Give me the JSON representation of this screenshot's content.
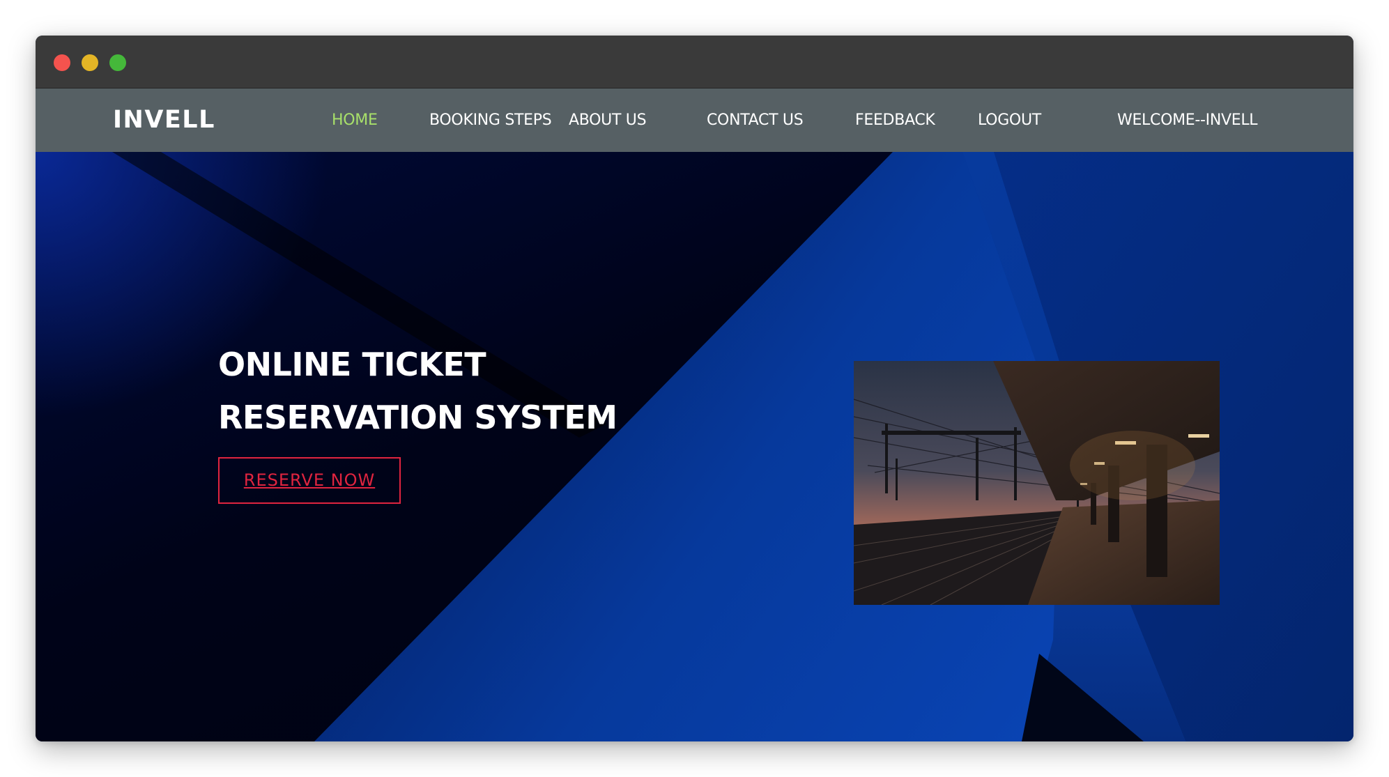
{
  "window": {
    "controls": [
      "close",
      "minimize",
      "maximize"
    ]
  },
  "nav": {
    "logo": "INVELL",
    "items": [
      {
        "label": "HOME",
        "active": true
      },
      {
        "label": "BOOKING STEPS",
        "active": false
      },
      {
        "label": "ABOUT US",
        "active": false
      },
      {
        "label": "CONTACT US",
        "active": false
      },
      {
        "label": "FEEDBACK",
        "active": false
      },
      {
        "label": "LOGOUT",
        "active": false
      },
      {
        "label": "WELCOME--INVELL",
        "active": false
      }
    ]
  },
  "hero": {
    "title_line1": "ONLINE TICKET",
    "title_line2": "RESERVATION SYSTEM",
    "cta_label": "RESERVE NOW",
    "image_alt": "train-station-platform-at-dusk"
  },
  "colors": {
    "nav_bg": "#566064",
    "nav_active": "#a8e06a",
    "cta": "#e0243f",
    "hero_blue": "#0a3a9c",
    "hero_dark": "#01041a"
  }
}
